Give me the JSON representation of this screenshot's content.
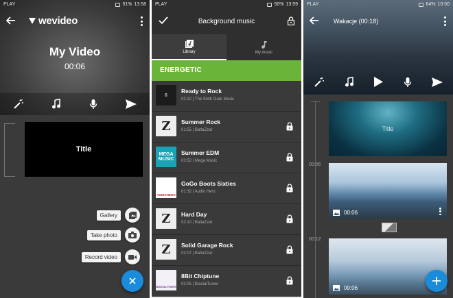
{
  "status_bars": [
    {
      "carrier": "PLAY",
      "battery": "51%",
      "time": "13:58"
    },
    {
      "carrier": "PLAY",
      "battery": "50%",
      "time": "13:59"
    },
    {
      "carrier": "PLAY",
      "battery": "64%",
      "time": "10:50"
    }
  ],
  "editor": {
    "logo": "wevideo",
    "video_title": "My Video",
    "duration": "00:06",
    "title_clip_text": "Title",
    "menu": {
      "gallery": "Gallery",
      "take_photo": "Take photo",
      "record_video": "Record video"
    },
    "fab_icon": "close-icon"
  },
  "music": {
    "header_title": "Background music",
    "tabs": [
      {
        "label": "Library",
        "icon": "library-icon"
      },
      {
        "label": "My music",
        "icon": "music-note-icon"
      }
    ],
    "genre": "ENERGETIC",
    "tracks": [
      {
        "title": "Ready to Rock",
        "meta": "02:10 | The Sixth Gate Music",
        "locked": false,
        "art_color": "#1c1c1c",
        "art_text": "6"
      },
      {
        "title": "Summer Rock",
        "meta": "01:55 | BaltaZzar",
        "locked": true,
        "art_color": "#eeeeee",
        "art_text": "Z"
      },
      {
        "title": "Summer EDM",
        "meta": "03:52 | Mega Music",
        "locked": true,
        "art_color": "#19a3b8",
        "art_text": "MEGA MUSIC"
      },
      {
        "title": "GoGo Boots Sixties",
        "meta": "01:32 | Audio Hero",
        "locked": true,
        "art_color": "#ffffff",
        "art_text": "AUDIOHERO"
      },
      {
        "title": "Hard Day",
        "meta": "02:10 | BaltaZzar",
        "locked": true,
        "art_color": "#eeeeee",
        "art_text": "Z"
      },
      {
        "title": "Solid Garage Rock",
        "meta": "02:07 | BaltaZzar",
        "locked": true,
        "art_color": "#eeeeee",
        "art_text": "Z"
      },
      {
        "title": "8Bit Chiptune",
        "meta": "02:05 | BiaxialTunes",
        "locked": true,
        "art_color": "#f4f0f8",
        "art_text": "BIAXIALTUNES"
      }
    ]
  },
  "project": {
    "title": "Wakacje (00:18)",
    "title_clip_text": "Title",
    "time_marks": [
      "00:06",
      "00:12"
    ],
    "clips": [
      {
        "duration": "00:06"
      },
      {
        "duration": "00:06"
      }
    ]
  }
}
